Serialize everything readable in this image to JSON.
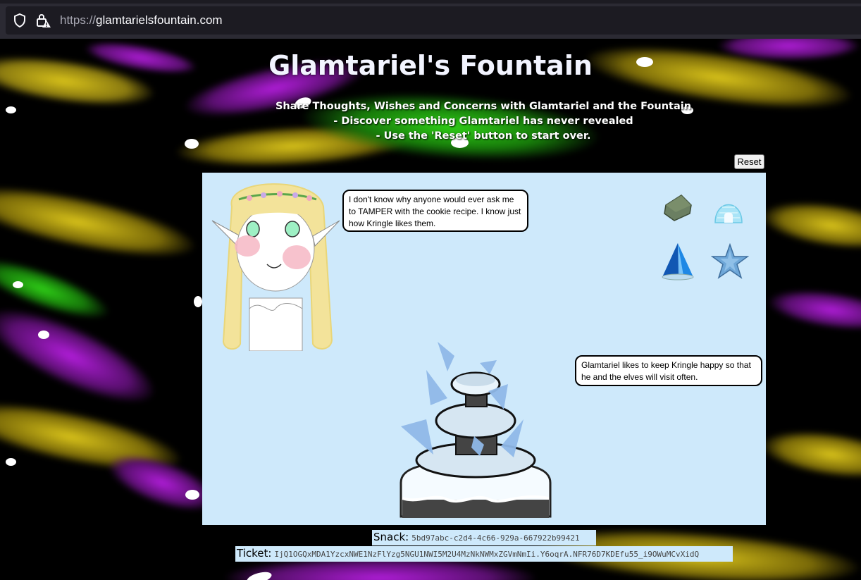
{
  "browser": {
    "url_protocol": "https://",
    "url_domain": "glamtarielsfountain.com"
  },
  "page": {
    "title": "Glamtariel's Fountain",
    "subtitle_lines": [
      "Share Thoughts, Wishes and Concerns with Glamtariel and the Fountain",
      "- Discover something Glamtariel has never revealed",
      "- Use the 'Reset' button to start over."
    ],
    "reset_label": "Reset"
  },
  "dialog": {
    "glamtariel": "I don't know why anyone would ever ask me to TAMPER with the cookie recipe. I know just how Kringle likes them.",
    "fountain": "Glamtariel likes to keep Kringle happy so that he and the elves will visit often."
  },
  "items": [
    "ring-icon",
    "igloo-icon",
    "cone-icon",
    "star-icon"
  ],
  "footer": {
    "snack_label": "Snack:",
    "snack_value": "5bd97abc-c2d4-4c66-929a-667922b99421",
    "ticket_label": "Ticket:",
    "ticket_value": "IjQ1OGQxMDA1YzcxNWE1NzFlYzg5NGU1NWI5M2U4MzNkNWMxZGVmNmIi.Y6oqrA.NFR76D7KDEfu55_i9OWuMCvXidQ"
  },
  "colors": {
    "stage_bg": "#cee9fb",
    "streak_yellow": "#d8c21a",
    "streak_magenta": "#b01dd8",
    "streak_green": "#2fcf17"
  }
}
